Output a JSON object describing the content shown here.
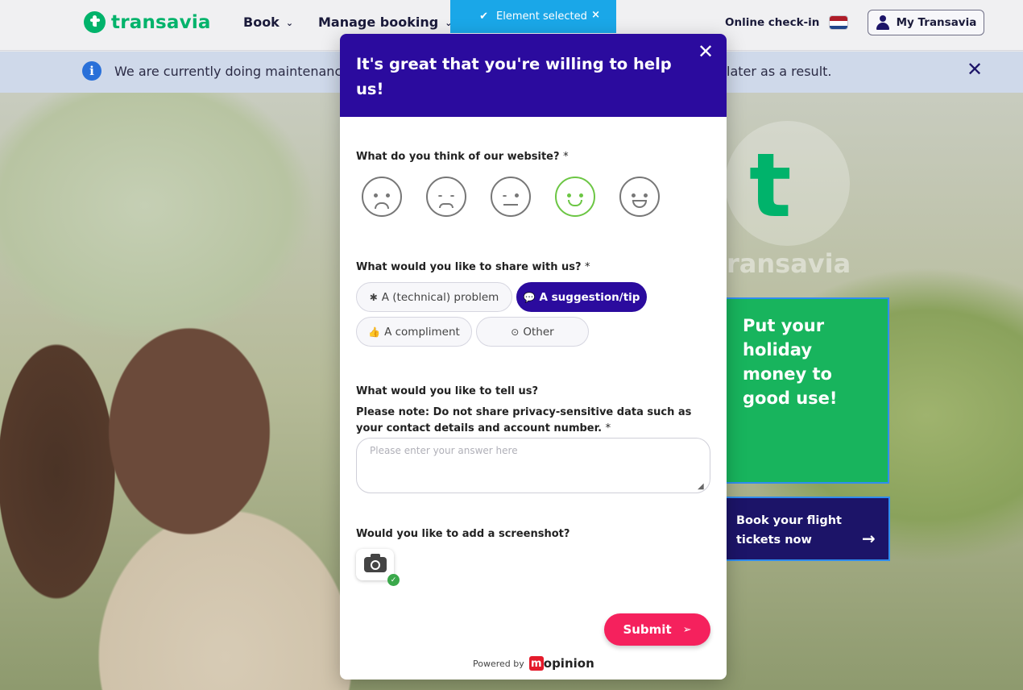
{
  "header": {
    "logo_text": "transavia",
    "nav": [
      {
        "label": "Book"
      },
      {
        "label": "Manage booking"
      }
    ],
    "checkin_label": "Online check-in",
    "my_account_label": "My Transavia"
  },
  "banner": {
    "text_left": "We are currently doing maintenance",
    "text_right": "later as a result."
  },
  "toast": {
    "label": "Element selected",
    "close": "×"
  },
  "hero": {
    "bg_logo_text": "ransavia",
    "promo_text": "Put your holiday money to good use!",
    "book_text": "Book your flight tickets now"
  },
  "modal": {
    "title": "It's great that you're willing to help us!",
    "q1": "What do you think of our website?",
    "q2": "What would you like to share with us?",
    "chips": [
      {
        "label": "A (technical) problem",
        "icon": "bug-icon"
      },
      {
        "label": "A suggestion/tip",
        "icon": "speech-bubble-icon"
      },
      {
        "label": "A compliment",
        "icon": "thumbs-up-icon"
      },
      {
        "label": "Other",
        "icon": "radio-icon"
      }
    ],
    "q3_line1": "What would you like to tell us?",
    "q3_line2": "Please note: Do not share privacy-sensitive data such as your contact details and account number.",
    "textarea_placeholder": "Please enter your answer here",
    "q4": "Would you like to add a screenshot?",
    "submit_label": "Submit",
    "powered_by": "Powered by",
    "brand": "opinion",
    "brand_mark": "m",
    "required_mark": "*"
  },
  "colors": {
    "brand_green": "#00b36b",
    "brand_purple": "#2b0b9e",
    "submit_pink": "#f5215d",
    "toast_blue": "#1aa7e8"
  }
}
